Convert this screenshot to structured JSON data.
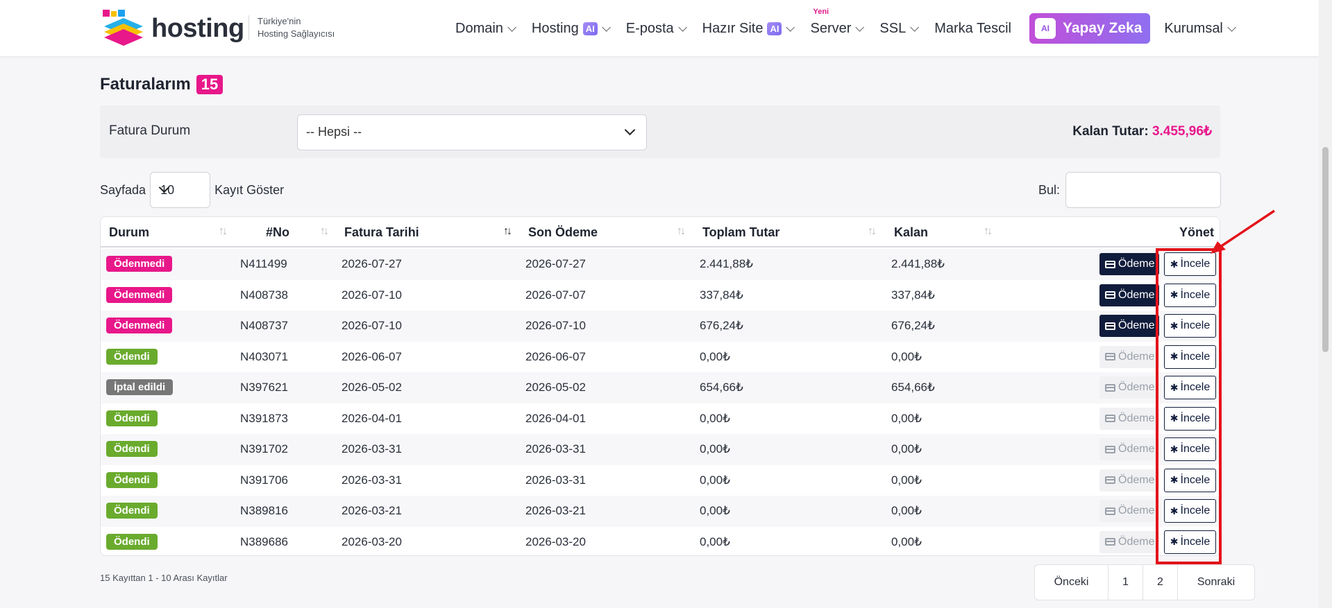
{
  "header": {
    "logo_text": "hosting",
    "tagline_line1": "Türkiye'nin",
    "tagline_line2": "Hosting Sağlayıcısı",
    "nav": [
      {
        "label": "Domain",
        "dropdown": true
      },
      {
        "label": "Hosting",
        "badge": "AI",
        "dropdown": true
      },
      {
        "label": "E-posta",
        "dropdown": true
      },
      {
        "label": "Hazır Site",
        "badge": "AI",
        "dropdown": true
      },
      {
        "label": "Server",
        "tag": "Yeni",
        "dropdown": true
      },
      {
        "label": "SSL",
        "dropdown": true
      },
      {
        "label": "Marka Tescil",
        "dropdown": false
      }
    ],
    "ai_button_icon": "AI",
    "ai_button_label": "Yapay Zeka",
    "last_nav": "Kurumsal"
  },
  "page": {
    "title": "Faturalarım",
    "count": "15"
  },
  "filter": {
    "label": "Fatura Durum",
    "selected": "-- Hepsi --",
    "remain_label": "Kalan Tutar:",
    "remain_value": "3.455,96₺"
  },
  "length": {
    "prefix": "Sayfada",
    "value": "10",
    "suffix": "Kayıt Göster"
  },
  "search": {
    "label": "Bul:",
    "value": ""
  },
  "table": {
    "headers": {
      "status": "Durum",
      "no": "#No",
      "date": "Fatura Tarihi",
      "due": "Son Ödeme",
      "total": "Toplam Tutar",
      "remain": "Kalan",
      "manage": "Yönet"
    },
    "pay_label": "Ödeme",
    "view_label": "İncele",
    "rows": [
      {
        "status": "Ödenmedi",
        "status_type": "unpaid",
        "no": "N411499",
        "date": "2026-07-27",
        "due": "2026-07-27",
        "total": "2.441,88₺",
        "remain": "2.441,88₺",
        "pay_active": true
      },
      {
        "status": "Ödenmedi",
        "status_type": "unpaid",
        "no": "N408738",
        "date": "2026-07-10",
        "due": "2026-07-07",
        "total": "337,84₺",
        "remain": "337,84₺",
        "pay_active": true
      },
      {
        "status": "Ödenmedi",
        "status_type": "unpaid",
        "no": "N408737",
        "date": "2026-07-10",
        "due": "2026-07-10",
        "total": "676,24₺",
        "remain": "676,24₺",
        "pay_active": true
      },
      {
        "status": "Ödendi",
        "status_type": "paid",
        "no": "N403071",
        "date": "2026-06-07",
        "due": "2026-06-07",
        "total": "0,00₺",
        "remain": "0,00₺",
        "pay_active": false
      },
      {
        "status": "İptal edildi",
        "status_type": "cancel",
        "no": "N397621",
        "date": "2026-05-02",
        "due": "2026-05-02",
        "total": "654,66₺",
        "remain": "654,66₺",
        "pay_active": false
      },
      {
        "status": "Ödendi",
        "status_type": "paid",
        "no": "N391873",
        "date": "2026-04-01",
        "due": "2026-04-01",
        "total": "0,00₺",
        "remain": "0,00₺",
        "pay_active": false
      },
      {
        "status": "Ödendi",
        "status_type": "paid",
        "no": "N391702",
        "date": "2026-03-31",
        "due": "2026-03-31",
        "total": "0,00₺",
        "remain": "0,00₺",
        "pay_active": false
      },
      {
        "status": "Ödendi",
        "status_type": "paid",
        "no": "N391706",
        "date": "2026-03-31",
        "due": "2026-03-31",
        "total": "0,00₺",
        "remain": "0,00₺",
        "pay_active": false
      },
      {
        "status": "Ödendi",
        "status_type": "paid",
        "no": "N389816",
        "date": "2026-03-21",
        "due": "2026-03-21",
        "total": "0,00₺",
        "remain": "0,00₺",
        "pay_active": false
      },
      {
        "status": "Ödendi",
        "status_type": "paid",
        "no": "N389686",
        "date": "2026-03-20",
        "due": "2026-03-20",
        "total": "0,00₺",
        "remain": "0,00₺",
        "pay_active": false
      }
    ]
  },
  "footer": {
    "info": "15 Kayıttan 1 - 10 Arası Kayıtlar",
    "prev": "Önceki",
    "pages": [
      "1",
      "2"
    ],
    "next": "Sonraki"
  },
  "colors": {
    "accent": "#e8178a",
    "navy": "#101c3c",
    "paid": "#6aab2e",
    "cancel": "#777777",
    "highlight": "#e3131b"
  }
}
